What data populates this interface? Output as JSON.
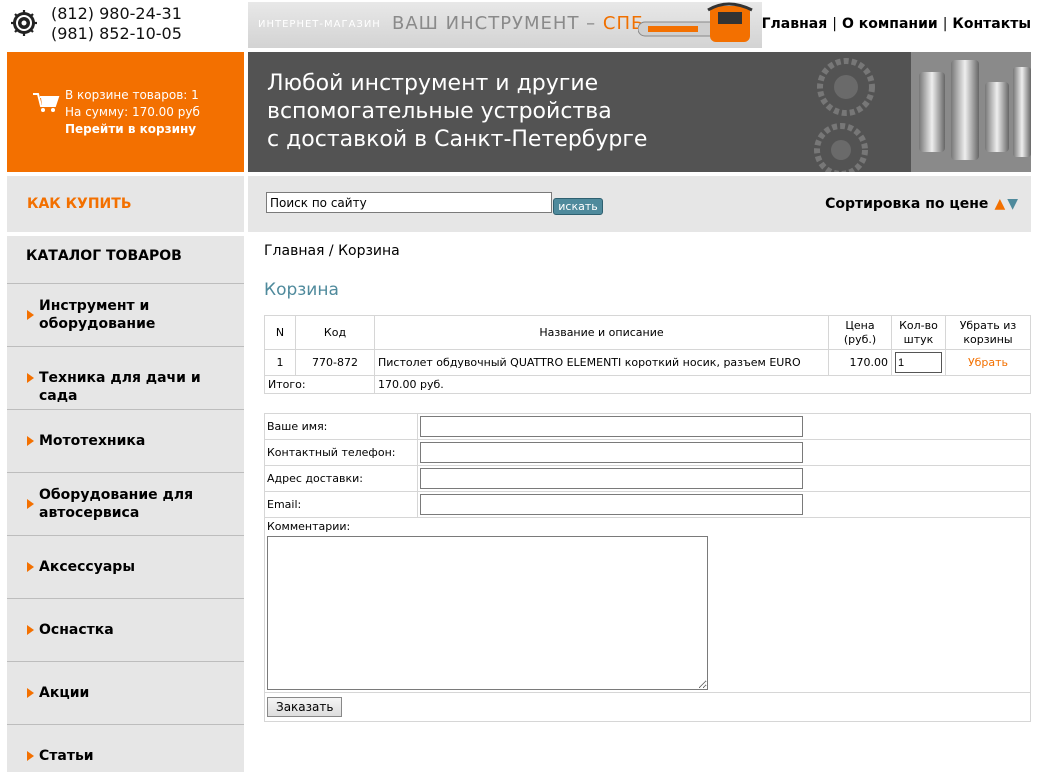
{
  "header": {
    "phones": [
      "(812) 980-24-31",
      "(981) 852-10-05"
    ],
    "banner_small": "ИНТЕРНЕТ-МАГАЗИН",
    "banner_big": "ВАШ ИНСТРУМЕНТ – ",
    "banner_city": "СПБ",
    "nav": [
      "Главная",
      "О компании",
      "Контакты"
    ]
  },
  "cart_summary": {
    "count_line": "В корзине товаров: 1",
    "sum_line": "На сумму: 170.00 руб",
    "go_link": "Перейти в корзину"
  },
  "hero": {
    "lines": [
      "Любой инструмент и другие",
      "вспомогательные устройства",
      "с доставкой в Санкт-Петербурге"
    ]
  },
  "sidebar": {
    "how_to_buy": "КАК КУПИТЬ",
    "catalog_title": "КАТАЛОГ ТОВАРОВ",
    "items": [
      {
        "line1": "Инструмент и",
        "line2": "оборудование"
      },
      {
        "line1": "Техника для дачи и сада",
        "line2": ""
      },
      {
        "line1": "Мототехника",
        "line2": ""
      },
      {
        "line1": "Оборудование для",
        "line2": "автосервиса"
      },
      {
        "line1": "Аксессуары",
        "line2": ""
      },
      {
        "line1": "Оснастка",
        "line2": ""
      },
      {
        "line1": "Акции",
        "line2": ""
      },
      {
        "line1": "Статьи",
        "line2": ""
      }
    ]
  },
  "search": {
    "value": "Поиск по сайту",
    "button": "искать",
    "sort_label": "Сортировка по цене",
    "sort_up": "▲",
    "sort_down": "▼"
  },
  "breadcrumb": "Главная / Корзина",
  "page_title": "Корзина",
  "cart_table": {
    "headers": {
      "n": "N",
      "code": "Код",
      "name": "Название и описание",
      "price_1": "Цена",
      "price_2": "(руб.)",
      "qty_1": "Кол-во",
      "qty_2": "штук",
      "remove_1": "Убрать из",
      "remove_2": "корзины"
    },
    "rows": [
      {
        "n": "1",
        "code": "770-872",
        "name": "Пистолет обдувочный QUATTRO ELEMENTI короткий носик, разъем EURO",
        "price": "170.00",
        "qty": "1",
        "remove": "Убрать"
      }
    ],
    "total_label": "Итого:",
    "total_value": "170.00 руб."
  },
  "order_form": {
    "name_label": "Ваше имя:",
    "phone_label": "Контактный телефон:",
    "address_label": "Адрес доставки:",
    "email_label": "Email:",
    "comment_label": "Комментарии:",
    "submit": "Заказать"
  },
  "colors": {
    "accent": "#f37000",
    "teal": "#4f8a9c",
    "hero_bg": "#535353",
    "panel_bg": "#e6e6e6"
  }
}
